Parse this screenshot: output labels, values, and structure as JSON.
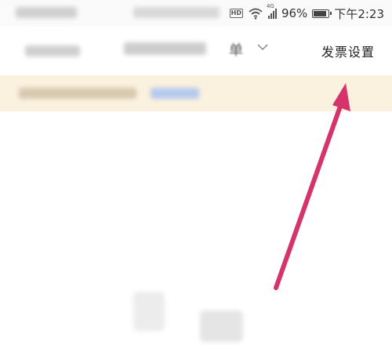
{
  "status_bar": {
    "hd_badge": "HD",
    "network_type": "4G",
    "battery_percent": "96%",
    "battery_level": 0.96,
    "time": "下午2:23",
    "icons": [
      "wifi-icon",
      "signal-icon",
      "battery-icon"
    ]
  },
  "header": {
    "title_partial": "单",
    "action_label": "发票设置",
    "icons": [
      "back-icon",
      "chevron-down-icon"
    ]
  },
  "colors": {
    "notice_background": "#fbf1df",
    "annotation_arrow": "#d6336c"
  },
  "annotation": {
    "type": "arrow",
    "target": "发票设置"
  }
}
